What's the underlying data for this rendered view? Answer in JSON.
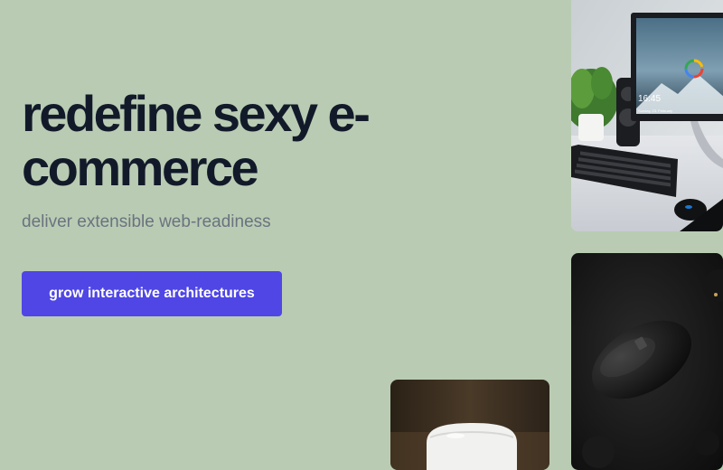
{
  "hero": {
    "headline": "redefine sexy e-commerce",
    "subheadline": "deliver extensible web-readiness",
    "cta_label": "grow interactive architectures"
  },
  "colors": {
    "background": "#b9ccb3",
    "headline": "#121a2a",
    "subheadline": "#6b7280",
    "cta_background": "#4f46e5",
    "cta_text": "#ffffff"
  },
  "images": [
    {
      "name": "desk-monitor-keyboard-photo",
      "description": ""
    },
    {
      "name": "black-mouse-photo",
      "description": ""
    },
    {
      "name": "white-earbuds-case-photo",
      "description": ""
    }
  ],
  "monitor_screen": {
    "time": "16:45",
    "date": "Sunday, 23. February"
  }
}
